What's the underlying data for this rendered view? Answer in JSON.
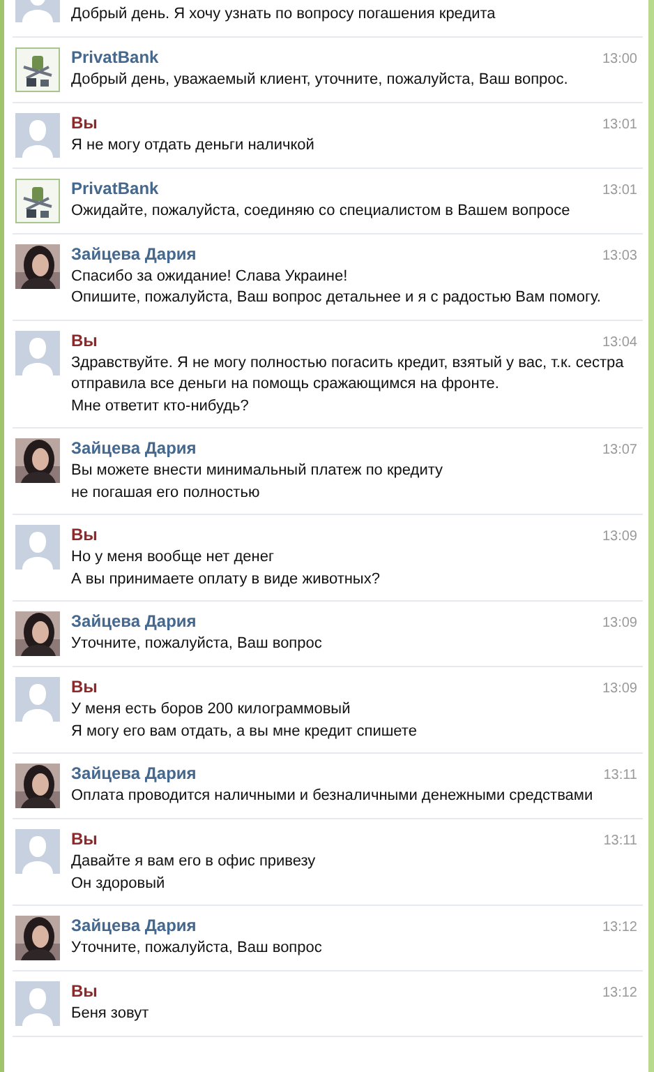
{
  "messages": [
    {
      "kind": "user",
      "lines": [
        "Добрый день. Я хочу узнать по вопросу погашения кредита"
      ]
    },
    {
      "kind": "bank",
      "author": "PrivatBank",
      "time": "13:00",
      "lines": [
        "Добрый день, уважаемый клиент, уточните, пожалуйста, Ваш вопрос."
      ]
    },
    {
      "kind": "user",
      "author": "Вы",
      "time": "13:01",
      "lines": [
        "Я не могу отдать деньги наличкой"
      ]
    },
    {
      "kind": "bank",
      "author": "PrivatBank",
      "time": "13:01",
      "lines": [
        "Ожидайте, пожалуйста, соединяю со специалистом в Вашем вопросе"
      ]
    },
    {
      "kind": "operator",
      "author": "Зайцева Дария",
      "time": "13:03",
      "lines": [
        "Спасибо за ожидание! Слава Украине!",
        "Опишите, пожалуйста, Ваш вопрос детальнее и я с радостью Вам помогу."
      ]
    },
    {
      "kind": "user",
      "author": "Вы",
      "time": "13:04",
      "lines": [
        "Здравствуйте. Я не могу полностью погасить кредит, взятый у вас, т.к. сестра",
        "отправила все деньги на помощь сражающимся на фронте.",
        "Мне ответит кто-нибудь?"
      ]
    },
    {
      "kind": "operator",
      "author": "Зайцева Дария",
      "time": "13:07",
      "lines": [
        "Вы можете внести минимальный платеж по кредиту",
        "не погашая его полностью"
      ]
    },
    {
      "kind": "user",
      "author": "Вы",
      "time": "13:09",
      "lines": [
        "Но у меня вообще нет денег",
        "А вы принимаете оплату в виде животных?"
      ]
    },
    {
      "kind": "operator",
      "author": "Зайцева Дария",
      "time": "13:09",
      "lines": [
        "Уточните, пожалуйста, Ваш вопрос"
      ]
    },
    {
      "kind": "user",
      "author": "Вы",
      "time": "13:09",
      "lines": [
        "У меня есть боров 200 килограммовый",
        "Я могу его вам отдать, а вы мне кредит спишете"
      ]
    },
    {
      "kind": "operator",
      "author": "Зайцева Дария",
      "time": "13:11",
      "lines": [
        "Оплата проводится наличными и безналичными денежными средствами"
      ]
    },
    {
      "kind": "user",
      "author": "Вы",
      "time": "13:11",
      "lines": [
        "Давайте я вам его в офис привезу",
        "Он здоровый"
      ]
    },
    {
      "kind": "operator",
      "author": "Зайцева Дария",
      "time": "13:12",
      "lines": [
        "Уточните, пожалуйста, Ваш вопрос"
      ]
    },
    {
      "kind": "user",
      "author": "Вы",
      "time": "13:12",
      "lines": [
        "Беня зовут"
      ]
    }
  ]
}
